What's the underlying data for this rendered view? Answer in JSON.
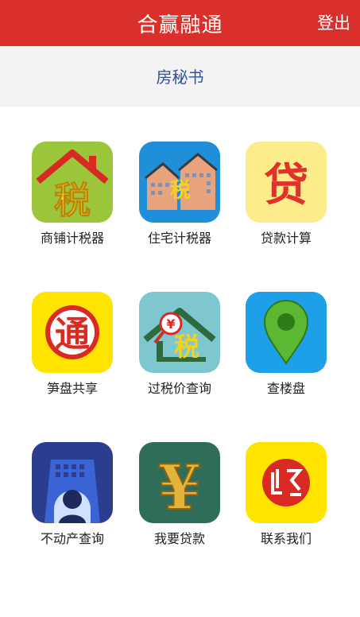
{
  "header": {
    "title": "合赢融通",
    "logout_label": "登出",
    "color": "#d9302b"
  },
  "subheader": {
    "title": "房秘书"
  },
  "grid": {
    "items": [
      {
        "label": "商铺计税器",
        "icon": "shop-tax-icon",
        "icon_text": "税"
      },
      {
        "label": "住宅计税器",
        "icon": "residential-tax-icon",
        "icon_text": "税"
      },
      {
        "label": "贷款计算",
        "icon": "loan-calc-icon",
        "icon_text": "贷"
      },
      {
        "label": "笋盘共享",
        "icon": "share-listing-icon",
        "icon_text": "通"
      },
      {
        "label": "过税价查询",
        "icon": "tax-price-query-icon",
        "icon_text": "税"
      },
      {
        "label": "查楼盘",
        "icon": "location-pin-icon"
      },
      {
        "label": "不动产查询",
        "icon": "property-query-icon"
      },
      {
        "label": "我要贷款",
        "icon": "yuan-icon",
        "icon_text": "¥"
      },
      {
        "label": "联系我们",
        "icon": "contact-seal-icon"
      }
    ]
  }
}
